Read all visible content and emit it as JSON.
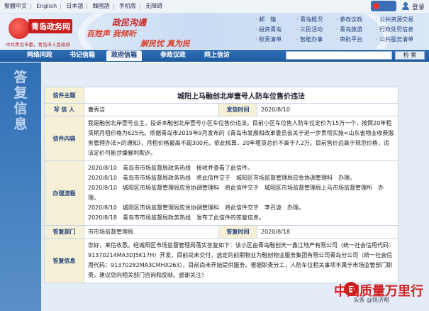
{
  "top_links": [
    "繁體中文",
    "English",
    "日本語",
    "韓國語",
    "手机版",
    "无障碍"
  ],
  "top_right": {
    "login": "登录"
  },
  "logo": {
    "title": "青岛政务网",
    "subtitle": "中共青岛市委，青岛市人民政府"
  },
  "banner": {
    "slogan1": "政民沟通",
    "slogan2": "百姓声 我倾听",
    "slogan3": "解民忧 真为民"
  },
  "quick_nav": [
    [
      "邮　箱",
      "青岛概况",
      "参政议政",
      "公共资源交易"
    ],
    [
      "投资青岛",
      "三民活动",
      "青岛旅游",
      "行政处罚信息"
    ],
    [
      "权责清单",
      "智能办事",
      "审批平台",
      "公共服务清单"
    ]
  ],
  "nav": {
    "items": [
      "网络问政",
      "书记信箱",
      "政府信箱",
      "参政议政",
      "网上信访"
    ],
    "active_index": 2,
    "search_placeholder": "",
    "search_button": "检 索"
  },
  "sidebar": {
    "title": "答复信息"
  },
  "letter": {
    "labels": {
      "subject": "信件主题",
      "writer": "写 信 人",
      "time": "发信时间",
      "content": "信件内容",
      "process": "办理流程",
      "dept": "答复部门",
      "reply_time": "答复时间",
      "reply": "答复信息"
    },
    "subject": "城阳上马融创北岸壹号人防车位售价违法",
    "writer": "曹秀洁",
    "time": "2020/8/10",
    "content": "我是融创北岸壹号业主，投诉本融创北岸壹号小区车位售价违法。目前小区车位售人防车位定价为15万一个，按照20年租赁期月租价格为625元。依据青岛市2019年9月发布的《青岛市发展和改革委员会关于进一步贯彻实施<山东省物业收费服务管理办法>的通知》，月租价格最高不超300元，依此核算，20年租赁总价不高于7.2万。目前售价远高于规范价格，违法定价可能涉嫌暴利欺诈。",
    "process": [
      "2020/8/10　青岛市市场监督局政务热线　接收并查看了此信件。",
      "2020/8/10　青岛市市场监督局政务热线　将此信件交于　城阳区市场监督管理局应急协调管理科　办理。",
      "2020/8/10　城阳区市场监督管理局应急协调管理科　将此信件交于　城阳区市场监督管理局上马市场监督管理所　办理。",
      "2020/8/10　城阳区市场监督管理局应急协调管理科　将此信件交于　李召波　办理。",
      "2020/8/18　青岛市市场监督局政务热线　发布了此信件的答复信息。"
    ],
    "dept": "市市场监督管理局",
    "reply_time": "2020/8/18",
    "reply": "您好，来信收悉。经城阳区市场监督管理局落实答复如下：该小区由青岛融创天一鑫江地产有限公司（统一社会信用代码：91370214MA3DJ5K17H）开发，目前尚未交付，选定的前期物业为融创物业服务集团有限公司青岛分公司（统一社会信用代码：91370282MA3CMHX263），目前尚未开始提供服务。根据职责分工，人防车位相关事项不属于市场监管部门职责，建议您向相关部门咨询和反映。感谢关注！"
  },
  "watermark": {
    "text": "中国质量万里行",
    "sub": "头条 @快济帮"
  }
}
